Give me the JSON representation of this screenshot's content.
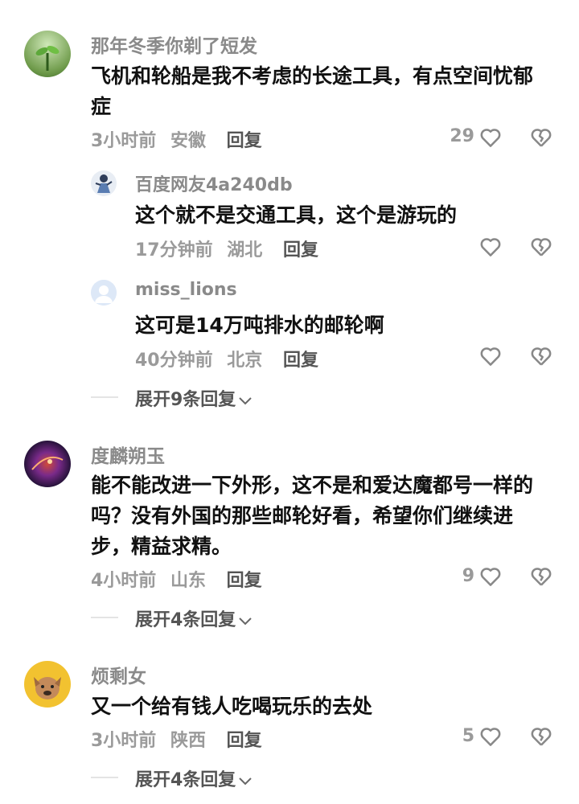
{
  "comments": [
    {
      "username": "那年冬季你剃了短发",
      "avatar": "plant-sprout-avatar",
      "text": "飞机和轮船是我不考虑的长途工具，有点空间忧郁症",
      "time": "3小时前",
      "location": "安徽",
      "reply_label": "回复",
      "likes": "29",
      "replies": [
        {
          "username": "百度网友4a240db",
          "avatar": "cartoon-figure-avatar",
          "text": "这个就不是交通工具，这个是游玩的",
          "time": "17分钟前",
          "location": "湖北",
          "reply_label": "回复"
        },
        {
          "username": "miss_lions",
          "avatar": "default-user-avatar",
          "text": "这可是14万吨排水的邮轮啊",
          "time": "40分钟前",
          "location": "北京",
          "reply_label": "回复"
        }
      ],
      "expand_label": "展开9条回复"
    },
    {
      "username": "度麟朔玉",
      "avatar": "purple-nebula-avatar",
      "text": "能不能改进一下外形，这不是和爱达魔都号一样的吗？没有外国的那些邮轮好看，希望你们继续进步，精益求精。",
      "time": "4小时前",
      "location": "山东",
      "reply_label": "回复",
      "likes": "9",
      "expand_label": "展开4条回复"
    },
    {
      "username": "烦剩女",
      "avatar": "bulldog-avatar",
      "text": "又一个给有钱人吃喝玩乐的去处",
      "time": "3小时前",
      "location": "陕西",
      "reply_label": "回复",
      "likes": "5",
      "expand_label": "展开4条回复"
    }
  ],
  "colors": {
    "name": "#8a8a8a",
    "text": "#111111",
    "meta": "#9a9a9a",
    "icon": "#888888"
  }
}
